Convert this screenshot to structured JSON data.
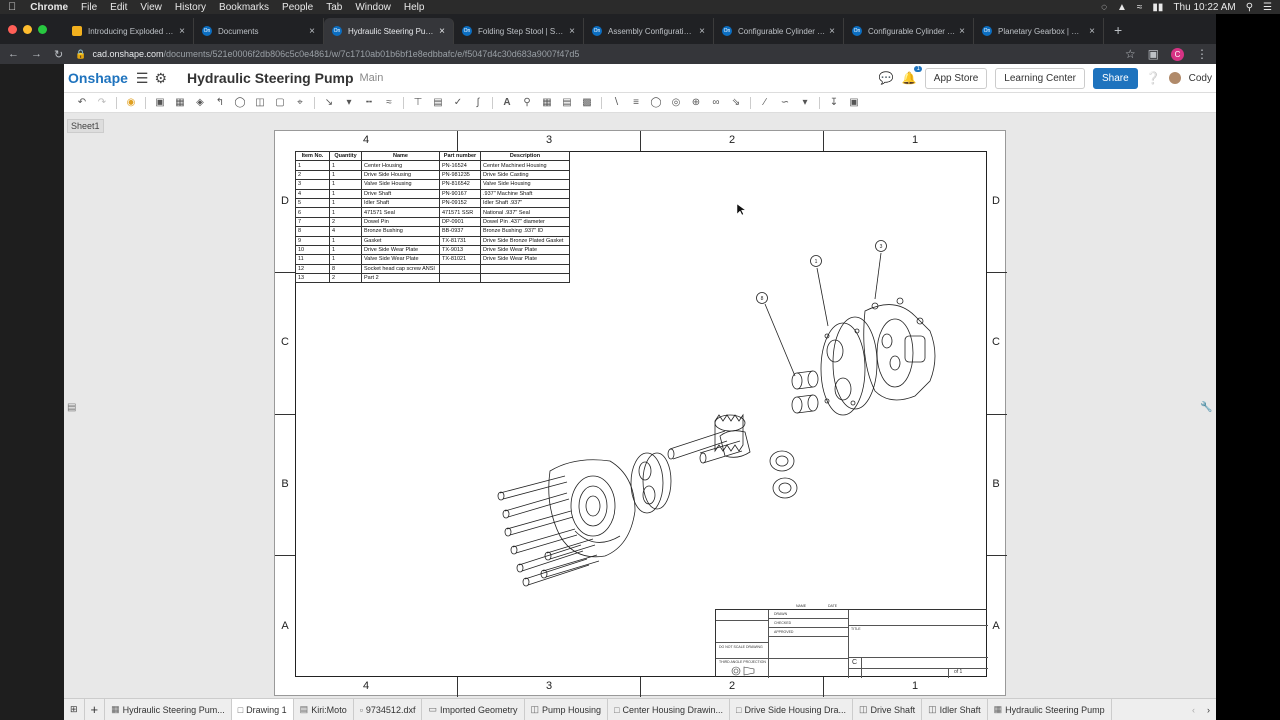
{
  "menubar": {
    "items": [
      "Chrome",
      "File",
      "Edit",
      "View",
      "History",
      "Bookmarks",
      "People",
      "Tab",
      "Window",
      "Help"
    ],
    "clock": "Thu 10:22 AM"
  },
  "browser": {
    "tabs": [
      {
        "label": "Introducing Exploded Vie"
      },
      {
        "label": "Documents"
      },
      {
        "label": "Hydraulic Steering Pump"
      },
      {
        "label": "Folding Step Stool | Step"
      },
      {
        "label": "Assembly Configurations"
      },
      {
        "label": "Configurable Cylinder | A"
      },
      {
        "label": "Configurable Cylinder | A"
      },
      {
        "label": "Planetary Gearbox | Mast"
      }
    ],
    "url_host": "cad.onshape.com",
    "url_path": "/documents/521e0006f2db806c5c0e4861/w/7c1710ab01b6bf1e8edbbafc/e/f5047d4c30d683a9007f47d5",
    "profile_initial": "C"
  },
  "header": {
    "logo": "Onshape",
    "doc_title": "Hydraulic Steering Pump",
    "branch": "Main",
    "notif_count": "1",
    "app_store": "App Store",
    "learning_center": "Learning Center",
    "share": "Share",
    "user": "Cody"
  },
  "sheet_label": "Sheet1",
  "drawing": {
    "zones_top": [
      "4",
      "3",
      "2",
      "1"
    ],
    "zones_side": [
      "D",
      "C",
      "B",
      "A"
    ],
    "bom_headers": [
      "Item No.",
      "Quantity",
      "Name",
      "Part number",
      "Description"
    ],
    "bom_rows": [
      [
        "1",
        "1",
        "Center Housing",
        "PN-16524",
        "Center Machined Housing"
      ],
      [
        "2",
        "1",
        "Drive Side Housing",
        "PN-981235",
        "Drive Side Casting"
      ],
      [
        "3",
        "1",
        "Valve Side Housing",
        "PN-816542",
        "Valve Side Housing"
      ],
      [
        "4",
        "1",
        "Drive Shaft",
        "PN-90167",
        ".937\" Machine Shaft"
      ],
      [
        "5",
        "1",
        "Idler Shaft",
        "PN-09152",
        "Idler Shaft .937\""
      ],
      [
        "6",
        "1",
        "471571 Seal",
        "471571 SSR",
        "National .937\" Seal"
      ],
      [
        "7",
        "2",
        "Dowel Pin",
        "DP-0901",
        "Dowel Pin .437\" diameter"
      ],
      [
        "8",
        "4",
        "Bronze Bushing",
        "BB-0937",
        "Bronze Bushing .937\" ID"
      ],
      [
        "9",
        "1",
        "Gasket",
        "TX-81731",
        "Drive Side Bronze Plated Gasket"
      ],
      [
        "10",
        "1",
        "Drive Side Wear Plate",
        "TX-9013",
        "Drive Side Wear Plate"
      ],
      [
        "11",
        "1",
        "Valve Side Wear Plate",
        "TX-81021",
        "Drive Side Wear Plate"
      ],
      [
        "12",
        "8",
        "Socket head cap screw ANSI",
        "",
        ""
      ],
      [
        "13",
        "2",
        "Part 2",
        "",
        ""
      ]
    ],
    "balloons": [
      "1",
      "3",
      "8"
    ],
    "title_block": {
      "size": "C",
      "sheet": "1",
      "of": "of 1",
      "drawn": "DRAWN",
      "checked": "CHECKED",
      "approved": "APPROVED",
      "name": "NAME",
      "date": "DATE",
      "title": "TITLE",
      "note": "DO NOT SCALE DRAWING",
      "projection": "THIRD ANGLE PROJECTION"
    }
  },
  "bottom_tabs": [
    {
      "label": "Hydraulic Steering Pum...",
      "icon": "assembly-icon"
    },
    {
      "label": "Drawing 1",
      "icon": "drawing-icon"
    },
    {
      "label": "Kiri:Moto",
      "icon": "app-icon"
    },
    {
      "label": "9734512.dxf",
      "icon": "file-icon"
    },
    {
      "label": "Imported Geometry",
      "icon": "folder-icon"
    },
    {
      "label": "Pump Housing",
      "icon": "partstudio-icon"
    },
    {
      "label": "Center Housing Drawin...",
      "icon": "drawing-icon"
    },
    {
      "label": "Drive Side Housing Dra...",
      "icon": "drawing-icon"
    },
    {
      "label": "Drive Shaft",
      "icon": "partstudio-icon"
    },
    {
      "label": "Idler Shaft",
      "icon": "partstudio-icon"
    },
    {
      "label": "Hydraulic Steering Pump",
      "icon": "assembly-icon"
    }
  ],
  "colors": {
    "accent": "#1e73be",
    "tab_bg": "#202124"
  }
}
